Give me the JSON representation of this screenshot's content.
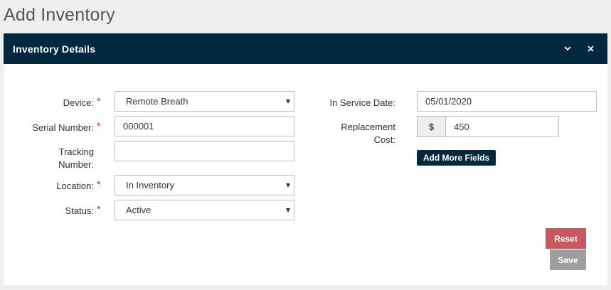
{
  "page": {
    "title": "Add Inventory"
  },
  "panel": {
    "title": "Inventory Details"
  },
  "form": {
    "device": {
      "label": "Device:",
      "required": "*",
      "value": "Remote Breath"
    },
    "serial_number": {
      "label": "Serial Number:",
      "required": "*",
      "value": "000001"
    },
    "tracking_number": {
      "label_line1": "Tracking",
      "label_line2": "Number:",
      "value": ""
    },
    "location": {
      "label": "Location:",
      "required": "*",
      "value": "In Inventory"
    },
    "status": {
      "label": "Status:",
      "required": "*",
      "value": "Active"
    },
    "in_service_date": {
      "label": "In Service Date:",
      "value": "05/01/2020"
    },
    "replacement_cost": {
      "label_line1": "Replacement",
      "label_line2": "Cost:",
      "currency": "$",
      "value": "450"
    }
  },
  "buttons": {
    "add_more_fields": "Add More Fields",
    "reset": "Reset",
    "save": "Save"
  },
  "icons": {
    "collapse": "chevron-down-icon",
    "close": "close-icon"
  },
  "colors": {
    "header_bg": "#022840",
    "required": "#c9302c",
    "reset": "#c9575f",
    "save": "#9e9e9e"
  }
}
